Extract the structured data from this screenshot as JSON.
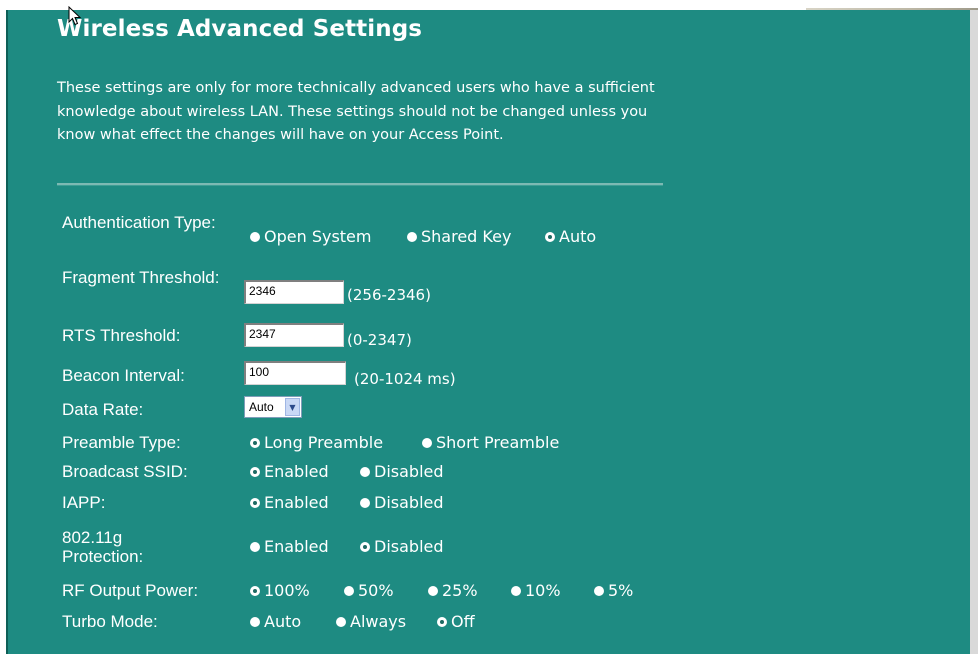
{
  "title": "Wireless Advanced Settings",
  "description": "These settings are only for more technically advanced users who have a sufficient knowledge about wireless LAN. These settings should not be changed unless you know what effect the changes will have on your Access Point.",
  "colors": {
    "panel_bg": "#1e8b82",
    "text": "#ffffff",
    "divider": "#7db9b3"
  },
  "auth": {
    "label": "Authentication Type:",
    "options": [
      {
        "label": "Open System",
        "checked": false
      },
      {
        "label": "Shared Key",
        "checked": false
      },
      {
        "label": "Auto",
        "checked": true
      }
    ]
  },
  "fragment": {
    "label": "Fragment Threshold:",
    "value": "2346",
    "hint": "(256-2346)"
  },
  "rts": {
    "label": "RTS Threshold:",
    "value": "2347",
    "hint": "(0-2347)"
  },
  "beacon": {
    "label": "Beacon Interval:",
    "value": "100",
    "hint": "(20-1024 ms)"
  },
  "data_rate": {
    "label": "Data Rate:",
    "value": "Auto",
    "icon": "chevron-down-icon"
  },
  "preamble": {
    "label": "Preamble Type:",
    "options": [
      {
        "label": "Long Preamble",
        "checked": true
      },
      {
        "label": "Short Preamble",
        "checked": false
      }
    ]
  },
  "broadcast": {
    "label": "Broadcast SSID:",
    "options": [
      {
        "label": "Enabled",
        "checked": true
      },
      {
        "label": "Disabled",
        "checked": false
      }
    ]
  },
  "iapp": {
    "label": "IAPP:",
    "options": [
      {
        "label": "Enabled",
        "checked": true
      },
      {
        "label": "Disabled",
        "checked": false
      }
    ]
  },
  "protection": {
    "label": "802.11g Protection:",
    "options": [
      {
        "label": "Enabled",
        "checked": false
      },
      {
        "label": "Disabled",
        "checked": true
      }
    ]
  },
  "rf_power": {
    "label": "RF Output Power:",
    "options": [
      {
        "label": "100%",
        "checked": true
      },
      {
        "label": "50%",
        "checked": false
      },
      {
        "label": "25%",
        "checked": false
      },
      {
        "label": "10%",
        "checked": false
      },
      {
        "label": "5%",
        "checked": false
      }
    ]
  },
  "turbo": {
    "label": "Turbo Mode:",
    "options": [
      {
        "label": "Auto",
        "checked": false
      },
      {
        "label": "Always",
        "checked": false
      },
      {
        "label": "Off",
        "checked": true
      }
    ]
  }
}
